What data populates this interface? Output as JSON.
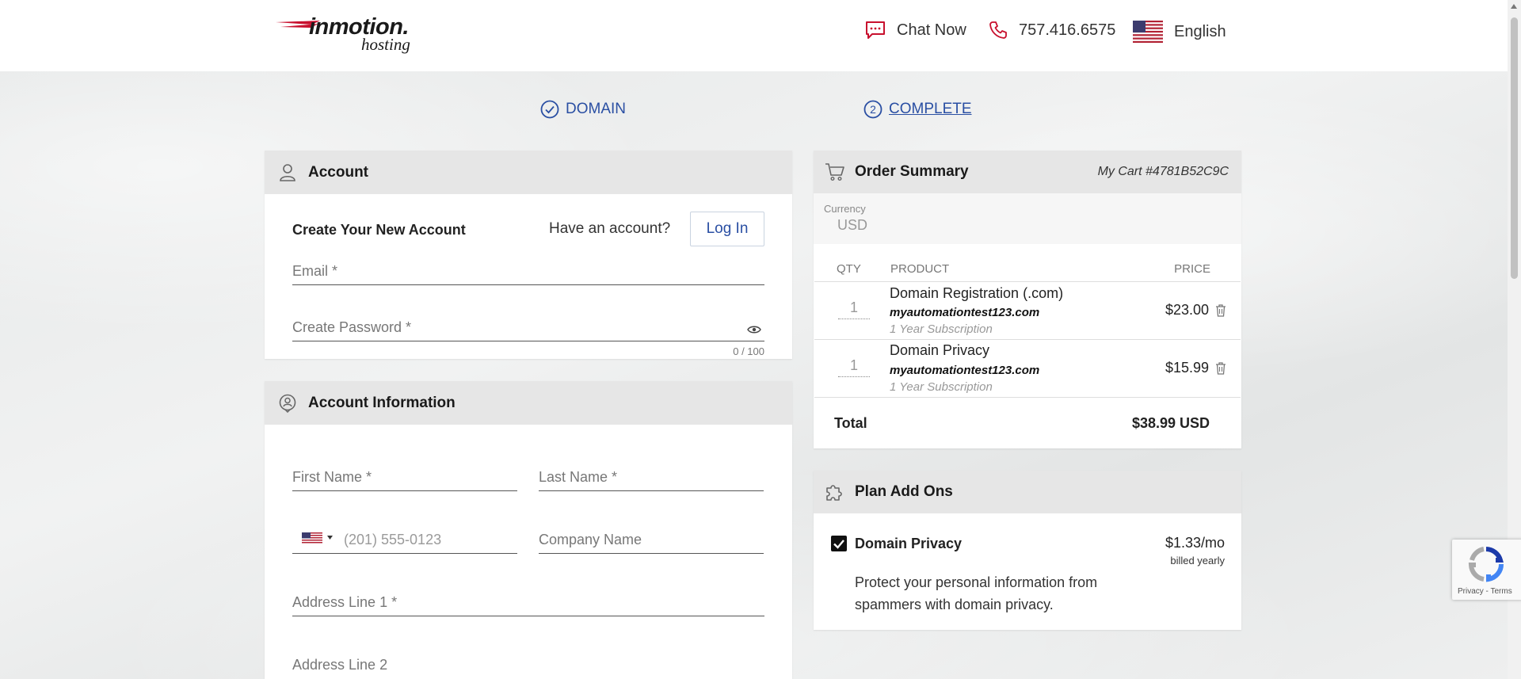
{
  "header": {
    "logo_top": "inmotion.",
    "logo_bottom": "hosting",
    "chat_label": "Chat Now",
    "phone": "757.416.6575",
    "language": "English"
  },
  "steps": {
    "step1_label": "DOMAIN",
    "step2_number": "2",
    "step2_label": "COMPLETE"
  },
  "account": {
    "title": "Account",
    "create_heading": "Create Your New Account",
    "have_account": "Have an account?",
    "login_label": "Log In",
    "email_label": "Email *",
    "password_label": "Create Password *",
    "password_counter": "0 / 100"
  },
  "account_info": {
    "title": "Account Information",
    "first_name_label": "First Name *",
    "last_name_label": "Last Name *",
    "phone_placeholder": "(201) 555-0123",
    "company_label": "Company Name",
    "address1_label": "Address Line 1 *",
    "address2_label": "Address Line 2"
  },
  "order_summary": {
    "title": "Order Summary",
    "cart_id": "My Cart #4781B52C9C",
    "currency_label": "Currency",
    "currency_value": "USD",
    "columns": [
      "QTY",
      "PRODUCT",
      "PRICE"
    ],
    "items": [
      {
        "qty": "1",
        "name": "Domain Registration (.com)",
        "domain": "myautomationtest123.com",
        "term": "1 Year Subscription",
        "price": "$23.00"
      },
      {
        "qty": "1",
        "name": "Domain Privacy",
        "domain": "myautomationtest123.com",
        "term": "1 Year Subscription",
        "price": "$15.99"
      }
    ],
    "total_label": "Total",
    "total_value": "$38.99 USD"
  },
  "addons": {
    "title": "Plan Add Ons",
    "item_name": "Domain Privacy",
    "item_checked": true,
    "item_price": "$1.33/mo",
    "item_billing": "billed yearly",
    "item_desc_line1": "Protect your personal information from",
    "item_desc_line2": "spammers with domain privacy."
  },
  "recaptcha": {
    "links": "Privacy - Terms"
  },
  "colors": {
    "accent": "#2a4fa3",
    "brand_red": "#c8102e"
  }
}
